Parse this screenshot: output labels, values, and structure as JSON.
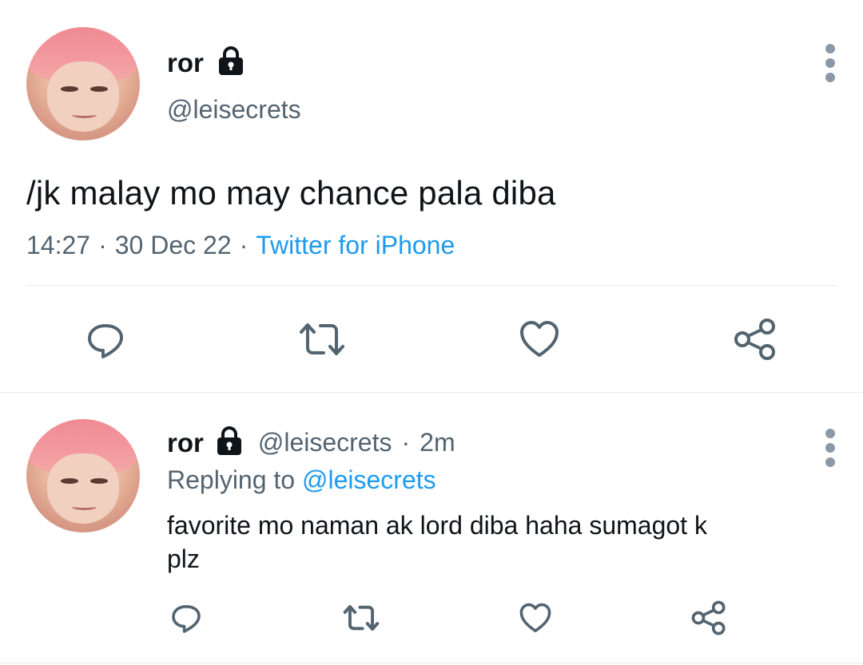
{
  "tweet": {
    "display_name": "ror",
    "handle": "@leisecrets",
    "text": "/jk malay mo may chance pala diba",
    "time": "14:27",
    "sep1": "·",
    "date": "30 Dec 22",
    "sep2": "·",
    "source": "Twitter for iPhone"
  },
  "reply": {
    "display_name": "ror",
    "handle": "@leisecrets",
    "sep": "·",
    "age": "2m",
    "replying_prefix": "Replying to",
    "replying_to": "@leisecrets",
    "text_line1": "favorite mo naman ak lord diba haha sumagot k",
    "text_line2": "plz"
  },
  "icons": {
    "actions": [
      "reply-icon",
      "retweet-icon",
      "like-icon",
      "share-icon"
    ],
    "more": "more-options-icon",
    "lock": "lock-icon"
  },
  "colors": {
    "text": "#0f1419",
    "muted": "#536471",
    "link": "#1d9bf0",
    "icon": "#536471",
    "divider": "#e6e9eb"
  }
}
